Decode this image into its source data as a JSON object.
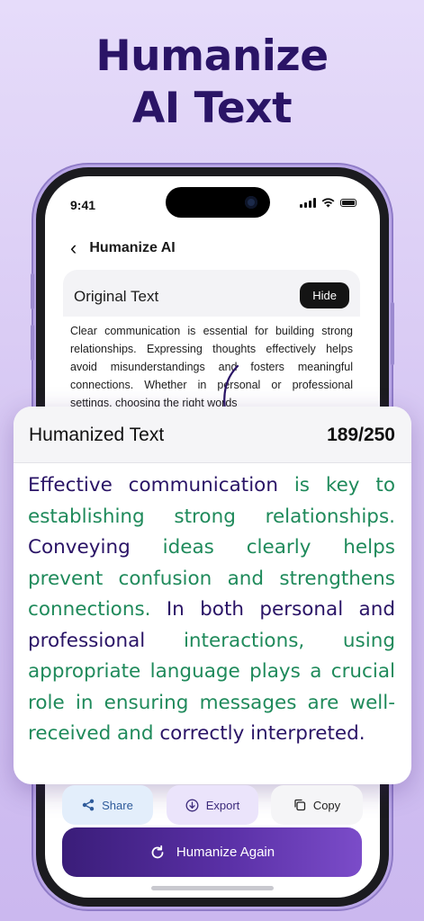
{
  "headline": {
    "line1": "Humanize",
    "line2": "AI Text"
  },
  "status_bar": {
    "time": "9:41"
  },
  "nav": {
    "title": "Humanize AI"
  },
  "original": {
    "heading": "Original Text",
    "hide_label": "Hide",
    "text": "Clear communication is essential for building strong relationships. Expressing thoughts effectively helps avoid misunderstandings and fosters meaningful connections. Whether in personal or professional settings, choosing the right words"
  },
  "humanized": {
    "heading": "Humanized Text",
    "count": "189/250",
    "segments": [
      {
        "text": "Effective communication ",
        "color": "#2a1466"
      },
      {
        "text": "is key to establishing strong relationships. ",
        "color": "#1f8a5b"
      },
      {
        "text": "Conveying ",
        "color": "#2a1466"
      },
      {
        "text": "ideas clearly helps prevent confusion and strengthens connections. ",
        "color": "#1f8a5b"
      },
      {
        "text": "In both personal and professional ",
        "color": "#2a1466"
      },
      {
        "text": "interactions, using appropriate language plays a crucial role in ensuring messages are well-received and ",
        "color": "#1f8a5b"
      },
      {
        "text": "correctly interpreted.",
        "color": "#2a1466"
      }
    ]
  },
  "actions": {
    "share": "Share",
    "export": "Export",
    "copy": "Copy"
  },
  "primary": {
    "label": "Humanize Again"
  },
  "colors": {
    "brand_dark": "#2a1466",
    "highlight_green": "#1f8a5b",
    "button_gradient_start": "#3a1d79",
    "button_gradient_end": "#7b4cc9"
  }
}
